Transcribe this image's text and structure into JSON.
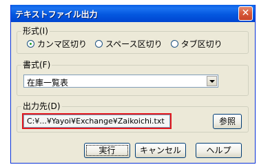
{
  "window": {
    "title": "テキストファイル出力",
    "close_glyph": "✕"
  },
  "format_group": {
    "label": "形式(I)",
    "options": [
      {
        "label": "カンマ区切り",
        "checked": true
      },
      {
        "label": "スペース区切り",
        "checked": false
      },
      {
        "label": "タブ区切り",
        "checked": false
      }
    ]
  },
  "style_group": {
    "label": "書式(F)",
    "selected_value": "在庫一覧表"
  },
  "output_group": {
    "label": "出力先(D)",
    "path_value": "C:¥...¥Yayoi¥Exchange¥Zaikoichi.txt",
    "browse_label": "参照"
  },
  "buttons": {
    "execute": "実行",
    "cancel": "キャンセル",
    "help": "ヘルプ"
  },
  "colors": {
    "highlight": "#e3161d",
    "titlebar": "#0458e0"
  }
}
